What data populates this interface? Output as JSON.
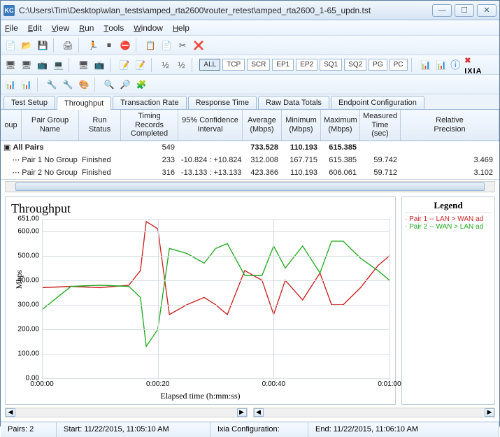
{
  "window": {
    "title": "C:\\Users\\Tim\\Desktop\\wlan_tests\\amped_rta2600\\router_retest\\amped_rta2600_1-65_updn.tst",
    "icon_label": "KC"
  },
  "menu": {
    "file": "File",
    "edit": "Edit",
    "view": "View",
    "run": "Run",
    "tools": "Tools",
    "window": "Window",
    "help": "Help"
  },
  "toolbar2": {
    "all": "ALL",
    "tcp": "TCP",
    "scr": "SCR",
    "ep1": "EP1",
    "ep2": "EP2",
    "sq1": "SQ1",
    "sq2": "SQ2",
    "pg": "PG",
    "pc": "PC"
  },
  "brand": "IXIA",
  "tabs": [
    "Test Setup",
    "Throughput",
    "Transaction Rate",
    "Response Time",
    "Raw Data Totals",
    "Endpoint Configuration"
  ],
  "active_tab": 1,
  "grid": {
    "headers": [
      "Group",
      "Pair Group Name",
      "Run Status",
      "Timing Records Completed",
      "95% Confidence Interval",
      "Average (Mbps)",
      "Minimum (Mbps)",
      "Maximum (Mbps)",
      "Measured Time (sec)",
      "Relative Precision"
    ],
    "rows": [
      {
        "label": "All Pairs",
        "group": "",
        "status": "",
        "records": "549",
        "conf": "",
        "avg": "733.528",
        "min": "110.193",
        "max": "615.385",
        "time": "",
        "prec": "",
        "bold": true
      },
      {
        "label": "Pair 1",
        "group": "No Group",
        "status": "Finished",
        "records": "233",
        "conf": "-10.824 : +10.824",
        "avg": "312.008",
        "min": "167.715",
        "max": "615.385",
        "time": "59.742",
        "prec": "3.469"
      },
      {
        "label": "Pair 2",
        "group": "No Group",
        "status": "Finished",
        "records": "316",
        "conf": "-13.133 : +13.133",
        "avg": "423.366",
        "min": "110.193",
        "max": "606.061",
        "time": "59.712",
        "prec": "3.102"
      }
    ]
  },
  "chart": {
    "title": "Throughput",
    "yaxis": "Mbps",
    "xaxis": "Elapsed time (h:mm:ss)",
    "yticks": [
      "0.00",
      "100.00",
      "200.00",
      "300.00",
      "400.00",
      "500.00",
      "600.00",
      "651.00"
    ],
    "xticks": [
      "0:00:00",
      "0:00:20",
      "0:00:40",
      "0:01:00"
    ]
  },
  "legend": {
    "title": "Legend",
    "items": [
      {
        "cls": "le-red",
        "text": "Pair 1 -- LAN > WAN ad"
      },
      {
        "cls": "le-grn",
        "text": "Pair 2 -- WAN > LAN ad"
      }
    ]
  },
  "status": {
    "pairs": "Pairs: 2",
    "start": "Start: 11/22/2015, 11:05:10 AM",
    "config": "Ixia Configuration:",
    "end": "End: 11/22/2015, 11:06:10 AM"
  },
  "chart_data": {
    "type": "line",
    "title": "Throughput",
    "xlabel": "Elapsed time (h:mm:ss)",
    "ylabel": "Mbps",
    "ylim": [
      0,
      651
    ],
    "x_seconds": [
      0,
      5,
      10,
      15,
      17,
      18,
      20,
      22,
      25,
      28,
      30,
      32,
      35,
      38,
      40,
      42,
      45,
      48,
      50,
      52,
      55,
      58,
      60
    ],
    "series": [
      {
        "name": "Pair 1 -- LAN > WAN",
        "color": "#cc2222",
        "values": [
          370,
          375,
          370,
          380,
          440,
          640,
          610,
          260,
          300,
          330,
          300,
          260,
          440,
          400,
          260,
          400,
          320,
          430,
          300,
          300,
          370,
          460,
          500
        ]
      },
      {
        "name": "Pair 2 -- WAN > LAN",
        "color": "#22aa22",
        "values": [
          280,
          375,
          380,
          375,
          330,
          130,
          200,
          530,
          510,
          470,
          530,
          550,
          420,
          420,
          540,
          450,
          540,
          430,
          560,
          560,
          490,
          440,
          400
        ]
      }
    ]
  }
}
